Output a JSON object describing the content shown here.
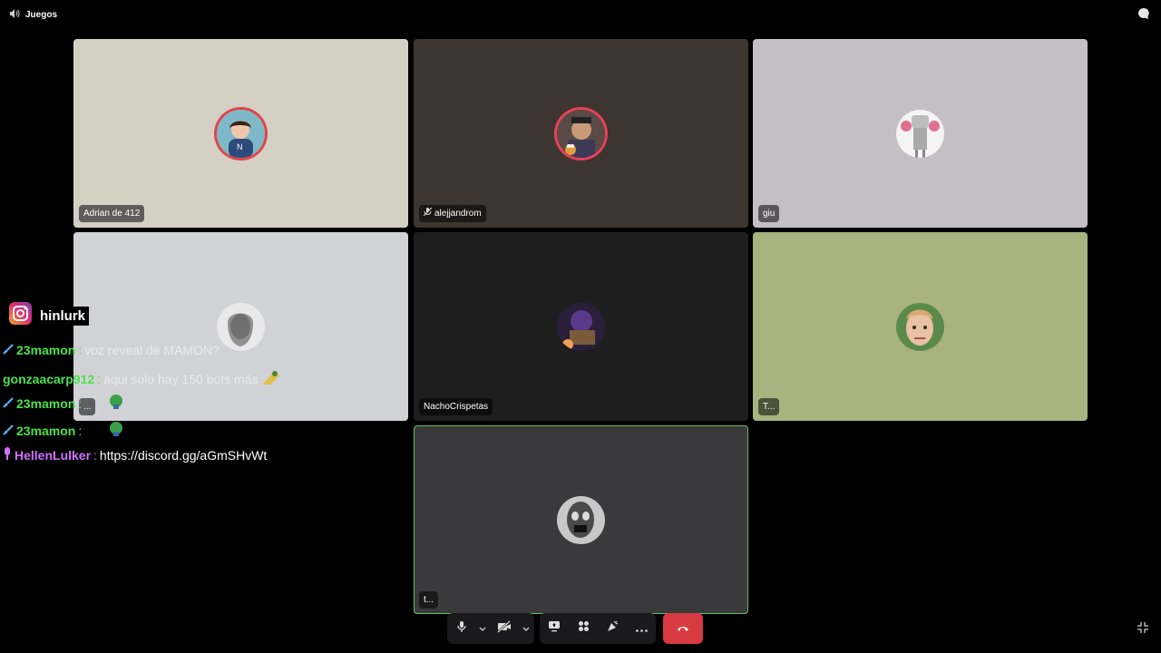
{
  "channel": {
    "name": "Juegos",
    "icon": "speaker-icon"
  },
  "header": {
    "chat_icon": "chat-bubble-icon"
  },
  "participants": [
    {
      "name": "Adrian de 412",
      "bg": "#d4d0c3",
      "ring": "#e0454b",
      "muted_icon": false
    },
    {
      "name": "alejjandrom",
      "bg": "#3c3530",
      "ring": "#e8405a",
      "muted_icon": true
    },
    {
      "name": "giu",
      "bg": "#c3bfc4",
      "ring": null,
      "muted_icon": false
    },
    {
      "name": "...",
      "bg": "#d1d2d6",
      "ring": null,
      "muted_icon": false
    },
    {
      "name": "NachoCrispetas",
      "bg": "#1f1e1e",
      "ring": null,
      "muted_icon": false
    },
    {
      "name": "T...",
      "bg": "#a8b380",
      "ring": null,
      "muted_icon": false
    },
    {
      "name": "t...",
      "bg": "#3a3a3c",
      "ring": null,
      "muted_icon": false,
      "speaking": true
    }
  ],
  "stream_overlay": {
    "instagram_handle": "hinlurk",
    "chat": [
      {
        "user": "23mamon",
        "color": "#4ee04e",
        "badge": "sword-icon",
        "sep": ":",
        "message": "voz reveal de MAMON?",
        "faded": true
      },
      {
        "user": "gonzaacarp912",
        "color": "#4ee04e",
        "badge": "",
        "sep": ":",
        "message": "aqui solo hay 150 bots más",
        "faded": true
      },
      {
        "user": "23mamon",
        "color": "#4ee04e",
        "badge": "sword-icon",
        "sep": ":",
        "message": "",
        "faded": true
      },
      {
        "user": "23mamon",
        "color": "#4ee04e",
        "badge": "sword-icon",
        "sep": ":",
        "message": "",
        "faded": false
      },
      {
        "user": "HellenLulker",
        "color": "#d070ff",
        "badge": "mic-badge-icon",
        "sep": ":",
        "message": "https://discord.gg/aGmSHvWt",
        "faded": false
      }
    ]
  },
  "controls": {
    "colors": {
      "hangup": "#d83a42",
      "bar": "#1a1a1c"
    }
  }
}
